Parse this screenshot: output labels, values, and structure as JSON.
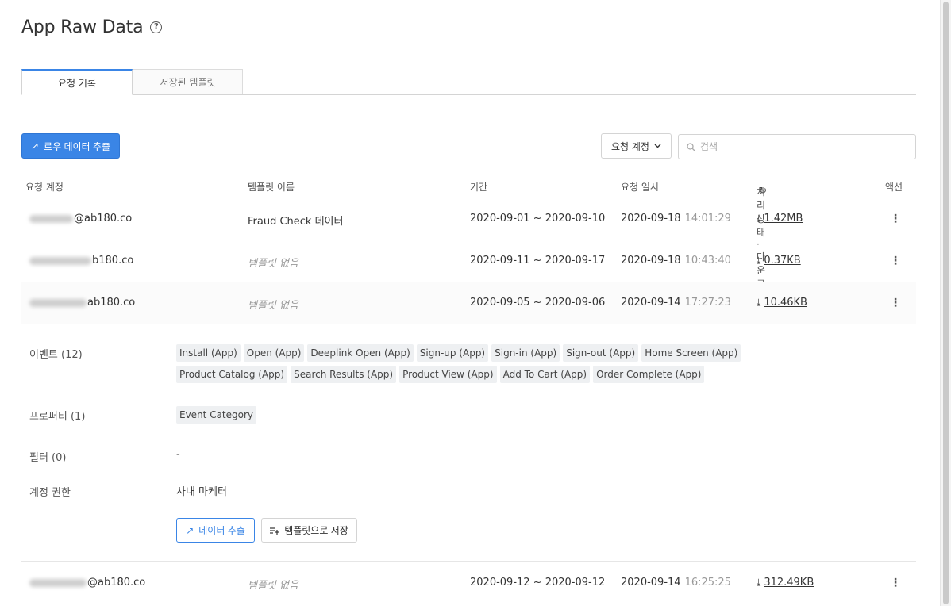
{
  "page": {
    "title": "App Raw Data",
    "help_icon": "help-circle-icon"
  },
  "tabs": [
    {
      "label": "요청 기록",
      "active": true
    },
    {
      "label": "저장된 템플릿",
      "active": false
    }
  ],
  "toolbar": {
    "extract_label": "로우 데이터 추출",
    "extract_icon": "arrow-up-right-icon",
    "filter_label": "요청 계정",
    "search_placeholder": "검색"
  },
  "table": {
    "headers": {
      "account": "요청 계정",
      "template": "템플릿 이름",
      "period": "기간",
      "requested_at": "요청 일시",
      "status": "처리상태·다운로드",
      "action": "액션"
    },
    "rows": [
      {
        "account": "@ab180.co",
        "template": "Fraud Check 데이터",
        "template_none": false,
        "period": "2020-09-01 ~ 2020-09-10",
        "date": "2020-09-18",
        "time": "14:01:29",
        "size": "1.42MB"
      },
      {
        "account": "b180.co",
        "template": "템플릿 없음",
        "template_none": true,
        "period": "2020-09-11 ~ 2020-09-17",
        "date": "2020-09-18",
        "time": "10:43:40",
        "size": "0.37KB"
      },
      {
        "account": "ab180.co",
        "template": "템플릿 없음",
        "template_none": true,
        "period": "2020-09-05 ~ 2020-09-06",
        "date": "2020-09-14",
        "time": "17:27:23",
        "size": "10.46KB",
        "expanded": true
      },
      {
        "account": "@ab180.co",
        "template": "템플릿 없음",
        "template_none": true,
        "period": "2020-09-12 ~ 2020-09-12",
        "date": "2020-09-14",
        "time": "16:25:25",
        "size": "312.49KB"
      }
    ]
  },
  "detail": {
    "events_label": "이벤트 (12)",
    "events": [
      "Install (App)",
      "Open (App)",
      "Deeplink Open (App)",
      "Sign-up (App)",
      "Sign-in (App)",
      "Sign-out (App)",
      "Home Screen (App)",
      "Product Catalog (App)",
      "Search Results (App)",
      "Product View (App)",
      "Add To Cart (App)",
      "Order Complete (App)"
    ],
    "properties_label": "프로퍼티 (1)",
    "properties": [
      "Event Category"
    ],
    "filter_label": "필터 (0)",
    "filter_value": "-",
    "permission_label": "계정 권한",
    "permission_value": "사내 마케터",
    "extract_button": "데이터 추출",
    "save_template_button": "템플릿으로 저장"
  },
  "colors": {
    "accent": "#3a85e6",
    "chip_bg": "#eef0f2"
  }
}
